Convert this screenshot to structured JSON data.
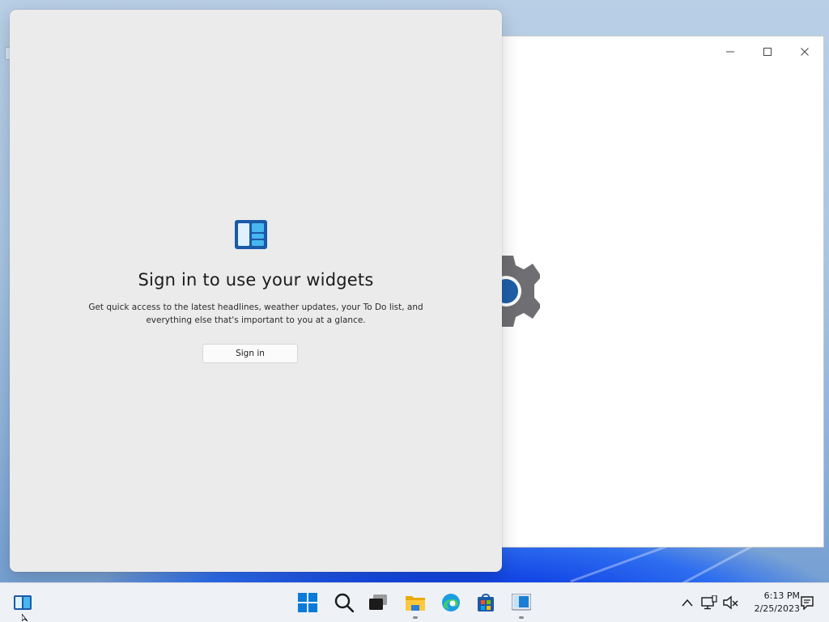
{
  "widgets": {
    "title": "Sign in to use your widgets",
    "description": "Get quick access to the latest headlines, weather updates, your To Do list, and everything else that's important to you at a glance.",
    "signin_label": "Sign in",
    "icon": "widgets-icon"
  },
  "settings_window": {
    "caption_buttons": [
      "minimize-icon",
      "maximize-icon",
      "close-icon"
    ],
    "icon": "settings-gear-icon"
  },
  "taskbar": {
    "left_item": "widgets-icon",
    "pinned": [
      {
        "name": "start-icon",
        "running": false
      },
      {
        "name": "search-icon",
        "running": false
      },
      {
        "name": "task-view-icon",
        "running": false
      },
      {
        "name": "file-explorer-icon",
        "running": true
      },
      {
        "name": "edge-icon",
        "running": false
      },
      {
        "name": "microsoft-store-icon",
        "running": false
      },
      {
        "name": "settings-app-icon",
        "running": true
      }
    ],
    "tray": [
      "chevron-up-icon",
      "network-icon",
      "volume-muted-icon",
      "notification-icon"
    ],
    "clock": {
      "time": "6:13 PM",
      "date": "2/25/2023"
    }
  },
  "colors": {
    "accent_blue": "#0f6cbd",
    "panel_bg": "#ebebeb",
    "taskbar_bg": "#eef1f6"
  }
}
